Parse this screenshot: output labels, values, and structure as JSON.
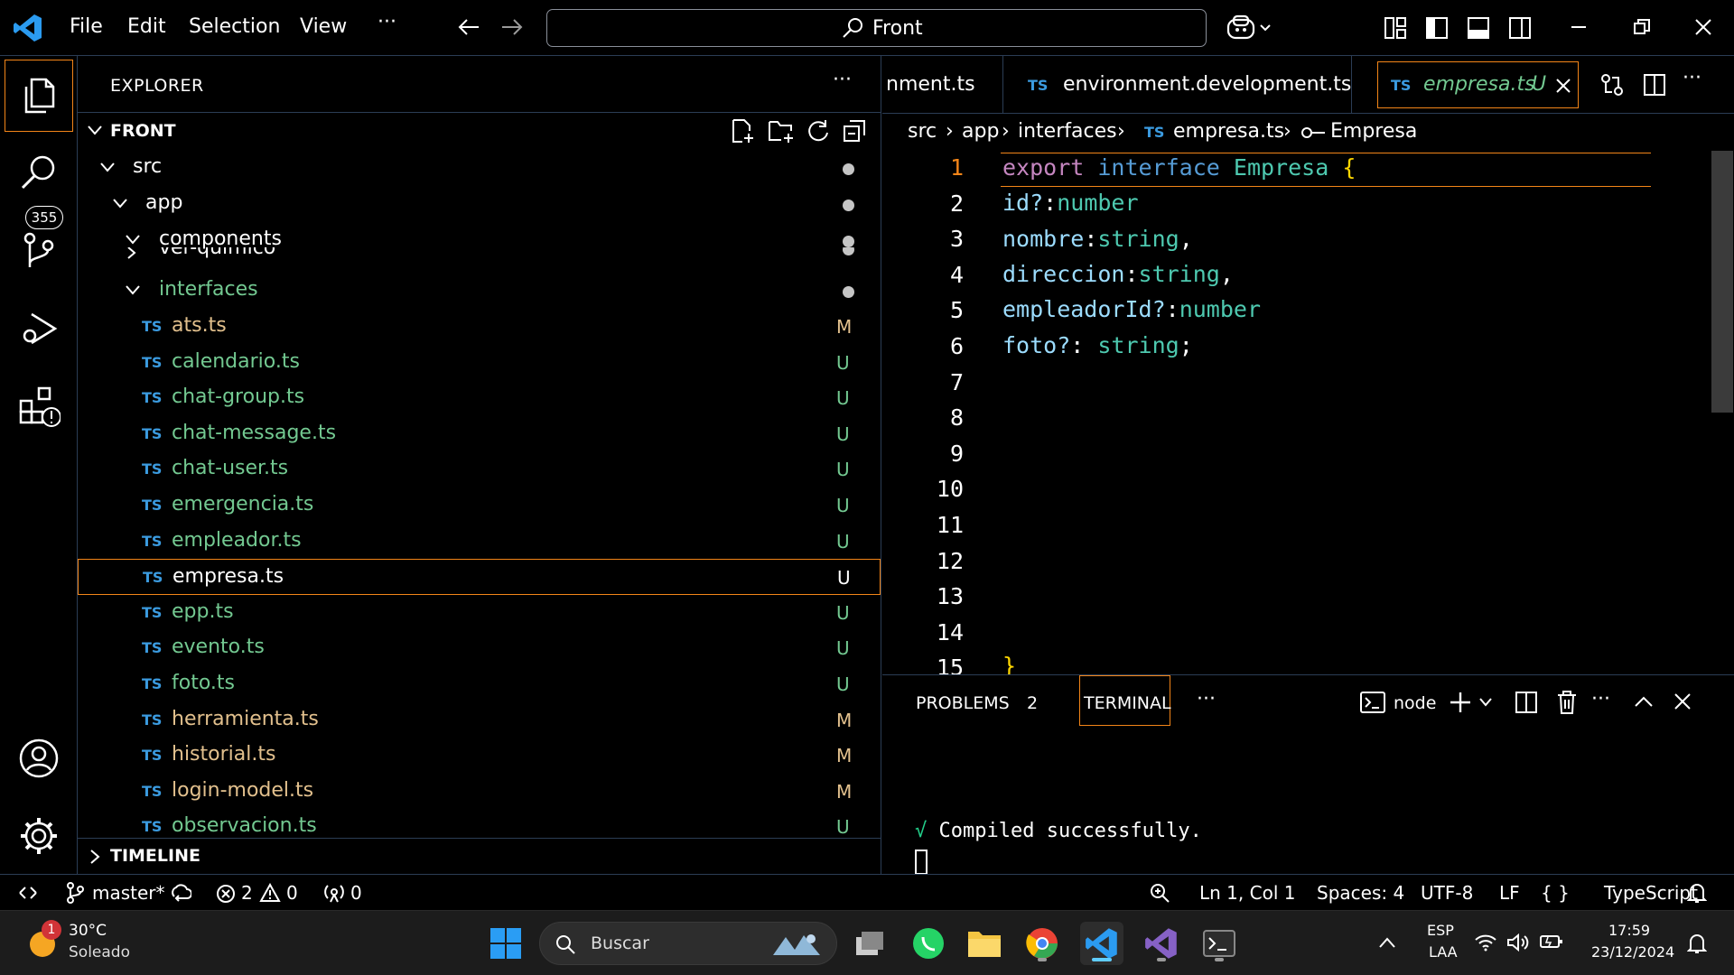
{
  "titlebar": {
    "menu": [
      "File",
      "Edit",
      "Selection",
      "View",
      "···"
    ],
    "search_text": "Front"
  },
  "activitybar": {
    "scm_badge": "355"
  },
  "sidebar": {
    "title": "EXPLORER",
    "more": "···",
    "section_title": "FRONT",
    "timeline_title": "TIMELINE",
    "tree": [
      {
        "label": "src",
        "type": "folder",
        "status": "dot"
      },
      {
        "label": "app",
        "type": "folder",
        "status": "dot"
      },
      {
        "label": "components",
        "type": "folder",
        "status": "dot"
      },
      {
        "label": "ver-quimico",
        "type": "folder-partial",
        "status": "dot"
      },
      {
        "label": "interfaces",
        "type": "folder",
        "status": "dot"
      },
      {
        "label": "ats.ts",
        "type": "file",
        "status": "M"
      },
      {
        "label": "calendario.ts",
        "type": "file",
        "status": "U"
      },
      {
        "label": "chat-group.ts",
        "type": "file",
        "status": "U"
      },
      {
        "label": "chat-message.ts",
        "type": "file",
        "status": "U"
      },
      {
        "label": "chat-user.ts",
        "type": "file",
        "status": "U"
      },
      {
        "label": "emergencia.ts",
        "type": "file",
        "status": "U"
      },
      {
        "label": "empleador.ts",
        "type": "file",
        "status": "U"
      },
      {
        "label": "empresa.ts",
        "type": "file",
        "status": "U"
      },
      {
        "label": "epp.ts",
        "type": "file",
        "status": "U"
      },
      {
        "label": "evento.ts",
        "type": "file",
        "status": "U"
      },
      {
        "label": "foto.ts",
        "type": "file",
        "status": "U"
      },
      {
        "label": "herramienta.ts",
        "type": "file",
        "status": "M"
      },
      {
        "label": "historial.ts",
        "type": "file",
        "status": "M"
      },
      {
        "label": "login-model.ts",
        "type": "file",
        "status": "M"
      },
      {
        "label": "observacion.ts",
        "type": "file",
        "status": "U"
      }
    ],
    "ts_badge": "TS"
  },
  "tabs": [
    {
      "label": "nment.ts"
    },
    {
      "label": "environment.development.ts"
    },
    {
      "label": "empresa.ts",
      "status": "U"
    }
  ],
  "breadcrumb": [
    "src",
    "app",
    "interfaces",
    "empresa.ts",
    "Empresa"
  ],
  "editor": {
    "line_numbers": [
      "1",
      "2",
      "3",
      "4",
      "5",
      "6",
      "7",
      "8",
      "9",
      "10",
      "11",
      "12",
      "13",
      "14",
      "15"
    ],
    "code": {
      "l1_export": "export",
      "l1_interface": "interface",
      "l1_name": "Empresa",
      "l1_brace": "{",
      "l2_prop": "id?",
      "l2_type": "number",
      "l3_prop": "nombre",
      "l3_type": "string",
      "l4_prop": "direccion",
      "l4_type": "string",
      "l5_prop": "empleadorId?",
      "l5_type": "number",
      "l6_prop": "foto?",
      "l6_type": "string",
      "l15_brace": "}"
    }
  },
  "panel": {
    "problems_label": "PROBLEMS",
    "problems_count": "2",
    "terminal_label": "TERMINAL",
    "more": "···",
    "shell": "node",
    "output_check": "√",
    "output": "Compiled successfully."
  },
  "statusbar": {
    "branch": "master*",
    "errors": "2",
    "warnings": "0",
    "ports": "0",
    "position": "Ln 1, Col 1",
    "spaces": "Spaces: 4",
    "encoding": "UTF-8",
    "eol": "LF",
    "language": "TypeScript",
    "language_brackets": "{ }"
  },
  "taskbar": {
    "weather_temp": "30°C",
    "weather_desc": "Soleado",
    "weather_badge": "1",
    "search_placeholder": "Buscar",
    "lang_top": "ESP",
    "lang_bottom": "LAA",
    "time": "17:59",
    "date": "23/12/2024"
  },
  "colors": {
    "accent_border": "#f38518",
    "untracked": "#73c991",
    "modified": "#e2c08d",
    "ts_icon": "#3b9be0"
  }
}
